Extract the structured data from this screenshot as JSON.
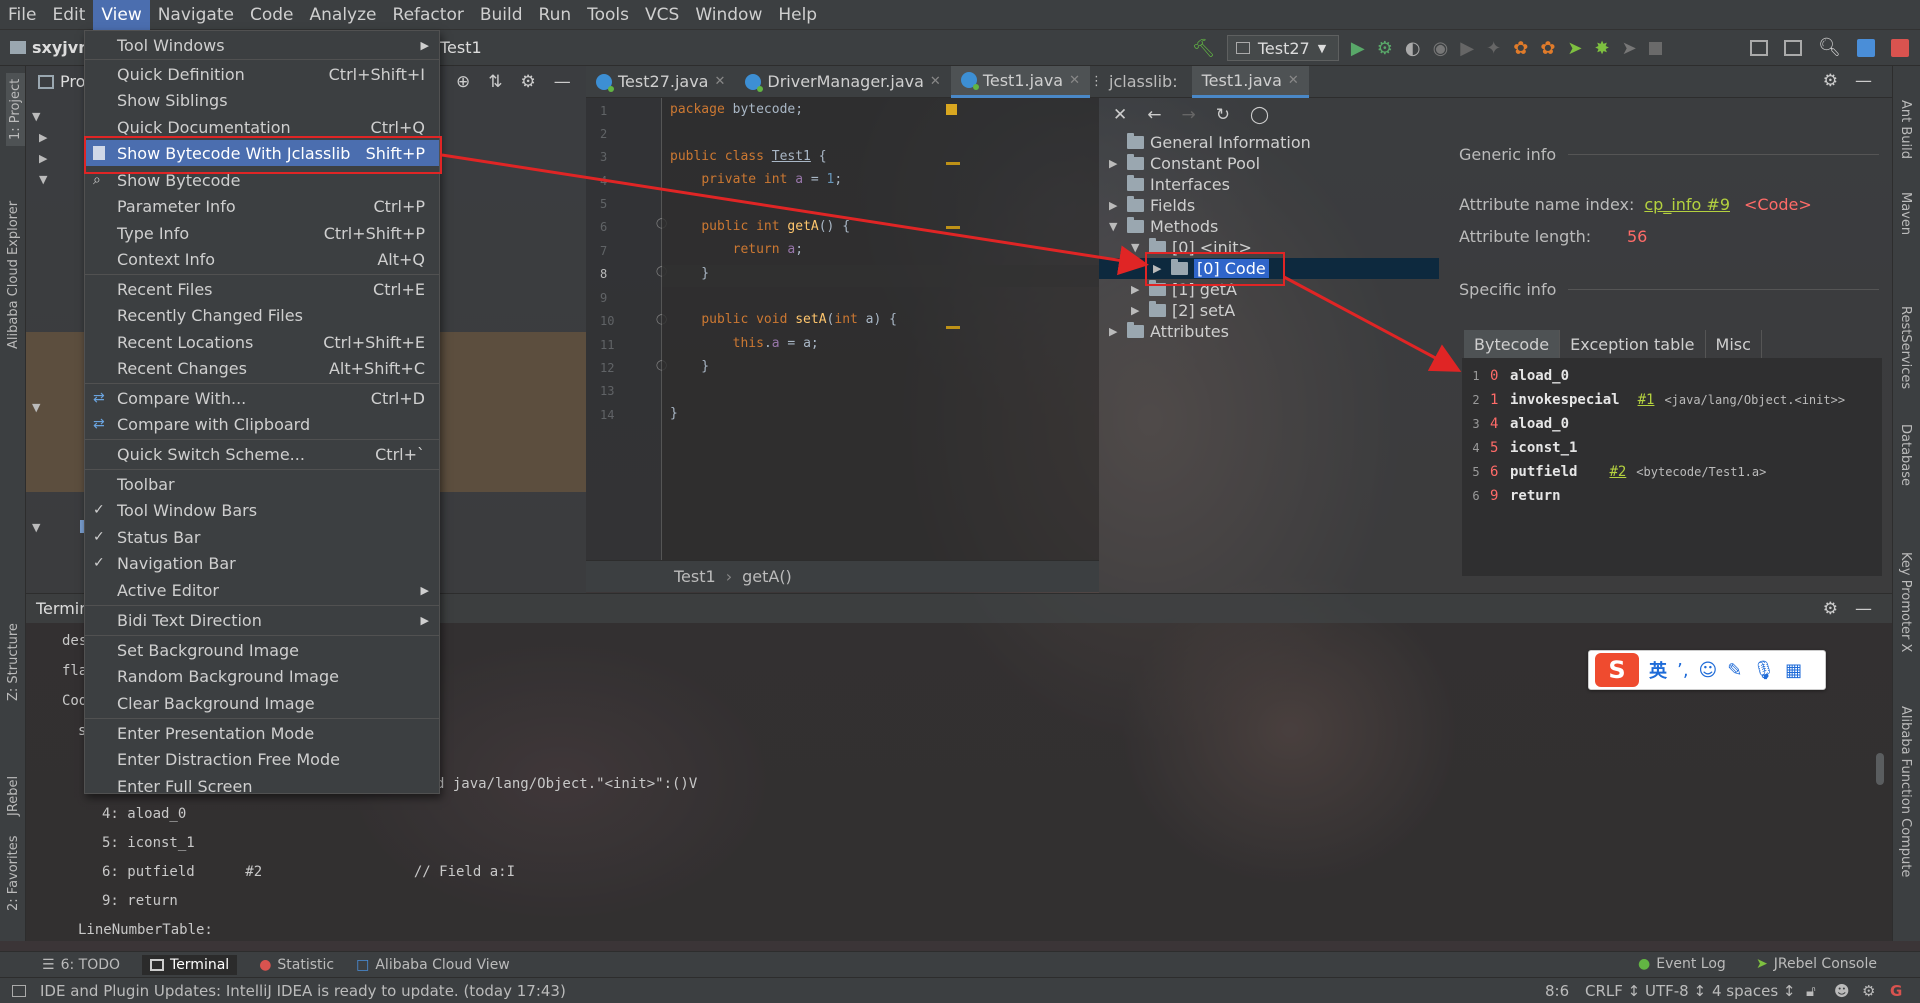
{
  "menubar": {
    "items": [
      "File",
      "Edit",
      "View",
      "Navigate",
      "Code",
      "Analyze",
      "Refactor",
      "Build",
      "Run",
      "Tools",
      "VCS",
      "Window",
      "Help"
    ],
    "active": "View"
  },
  "navbar": {
    "project": "sxyjvm",
    "file": "Test1",
    "run_config": "Test27"
  },
  "project_panel": {
    "title": "Pro",
    "label_fragment": "s"
  },
  "editor": {
    "tabs": [
      {
        "label": "Test27.java"
      },
      {
        "label": "DriverManager.java"
      },
      {
        "label": "Test1.java",
        "active": true
      }
    ],
    "tab_overflow": "⋮≡",
    "line_numbers": [
      "1",
      "2",
      "3",
      "4",
      "5",
      "6",
      "7",
      "8",
      "9",
      "10",
      "11",
      "12",
      "13",
      "14"
    ],
    "breadcrumb": [
      "Test1",
      "getA()"
    ]
  },
  "view_menu": {
    "items": [
      {
        "label": "Tool Windows",
        "shortcut": "",
        "submenu": true
      },
      {
        "label": "Quick Definition",
        "shortcut": "Ctrl+Shift+I"
      },
      {
        "label": "Show Siblings",
        "shortcut": ""
      },
      {
        "label": "Quick Documentation",
        "shortcut": "Ctrl+Q"
      },
      {
        "label": "Show Bytecode With Jclasslib",
        "shortcut": "Shift+P",
        "selected": true
      },
      {
        "label": "Show Bytecode",
        "shortcut": ""
      },
      {
        "label": "Parameter Info",
        "shortcut": "Ctrl+P"
      },
      {
        "label": "Type Info",
        "shortcut": "Ctrl+Shift+P"
      },
      {
        "label": "Context Info",
        "shortcut": "Alt+Q"
      },
      {
        "label": "Recent Files",
        "shortcut": "Ctrl+E"
      },
      {
        "label": "Recently Changed Files",
        "shortcut": ""
      },
      {
        "label": "Recent Locations",
        "shortcut": "Ctrl+Shift+E"
      },
      {
        "label": "Recent Changes",
        "shortcut": "Alt+Shift+C"
      },
      {
        "label": "Compare With...",
        "shortcut": "Ctrl+D"
      },
      {
        "label": "Compare with Clipboard",
        "shortcut": ""
      },
      {
        "label": "Quick Switch Scheme...",
        "shortcut": "Ctrl+`"
      },
      {
        "label": "Toolbar",
        "shortcut": ""
      },
      {
        "label": "Tool Window Bars",
        "shortcut": "",
        "checked": true
      },
      {
        "label": "Status Bar",
        "shortcut": "",
        "checked": true
      },
      {
        "label": "Navigation Bar",
        "shortcut": "",
        "checked": true
      },
      {
        "label": "Active Editor",
        "shortcut": "",
        "submenu": true
      },
      {
        "label": "Bidi Text Direction",
        "shortcut": "",
        "submenu": true
      },
      {
        "label": "Set Background Image",
        "shortcut": ""
      },
      {
        "label": "Random Background Image",
        "shortcut": ""
      },
      {
        "label": "Clear Background Image",
        "shortcut": ""
      },
      {
        "label": "Enter Presentation Mode",
        "shortcut": ""
      },
      {
        "label": "Enter Distraction Free Mode",
        "shortcut": ""
      },
      {
        "label": "Enter Full Screen",
        "shortcut": ""
      }
    ]
  },
  "jclasslib": {
    "tabs": [
      "jclasslib:",
      "Test1.java"
    ],
    "tree": {
      "general": "General Information",
      "constant_pool": "Constant Pool",
      "interfaces": "Interfaces",
      "fields": "Fields",
      "methods": "Methods",
      "init": "[0] <init>",
      "code": "[0] Code",
      "geta": "[1] getA",
      "seta": "[2] setA",
      "attributes": "Attributes"
    },
    "generic_info": {
      "heading": "Generic info",
      "name_index_label": "Attribute name index:",
      "name_index_link": "cp_info #9",
      "name_index_value": "<Code>",
      "length_label": "Attribute length:",
      "length_value": "56"
    },
    "specific_info": {
      "heading": "Specific info"
    },
    "bytecode_tabs": [
      "Bytecode",
      "Exception table",
      "Misc"
    ],
    "bytecode": [
      {
        "line": "1",
        "offset": "0",
        "op": "aload_0",
        "ref": "",
        "comment": ""
      },
      {
        "line": "2",
        "offset": "1",
        "op": "invokespecial",
        "ref": "#1",
        "comment": "<java/lang/Object.<init>>"
      },
      {
        "line": "3",
        "offset": "4",
        "op": "aload_0",
        "ref": "",
        "comment": ""
      },
      {
        "line": "4",
        "offset": "5",
        "op": "iconst_1",
        "ref": "",
        "comment": ""
      },
      {
        "line": "5",
        "offset": "6",
        "op": "putfield",
        "ref": "#2",
        "comment": "<bytecode/Test1.a>"
      },
      {
        "line": "6",
        "offset": "9",
        "op": "return",
        "ref": "",
        "comment": ""
      }
    ]
  },
  "terminal": {
    "title": "Termin",
    "lines": [
      "des",
      "fla",
      "Cod",
      "s"
    ],
    "invoke_fragment": "d java/lang/Object.\"<init>\":()V",
    "ops": [
      "4: aload_0",
      "5: iconst_1",
      "6: putfield      #2                  // Field a:I",
      "9: return"
    ],
    "lnt": "LineNumberTable:"
  },
  "left_stripe": [
    "1: Project",
    "Alibaba Cloud Explorer",
    "Z: Structure",
    "JRebel",
    "2: Favorites"
  ],
  "right_stripe": [
    "Ant Build",
    "Maven",
    "RestServices",
    "Database",
    "Key Promoter X",
    "Alibaba Function Compute"
  ],
  "tool_windows_bar": {
    "todo": "6: TODO",
    "terminal": "Terminal",
    "statistic": "Statistic",
    "alibaba": "Alibaba Cloud View",
    "event_log": "Event Log",
    "jrebel": "JRebel Console"
  },
  "status_bar": {
    "message": "IDE and Plugin Updates: IntelliJ IDEA is ready to update. (today 17:43)",
    "position": "8:6",
    "line_sep": "CRLF ↕",
    "encoding": "UTF-8 ↕",
    "indent": "4 spaces ↕"
  },
  "ime": {
    "label": "英"
  },
  "colors": {
    "accent": "#4b6eaf",
    "annotation_red": "#e02525",
    "link_green": "#b4d13f",
    "keyword": "#cc7832"
  }
}
